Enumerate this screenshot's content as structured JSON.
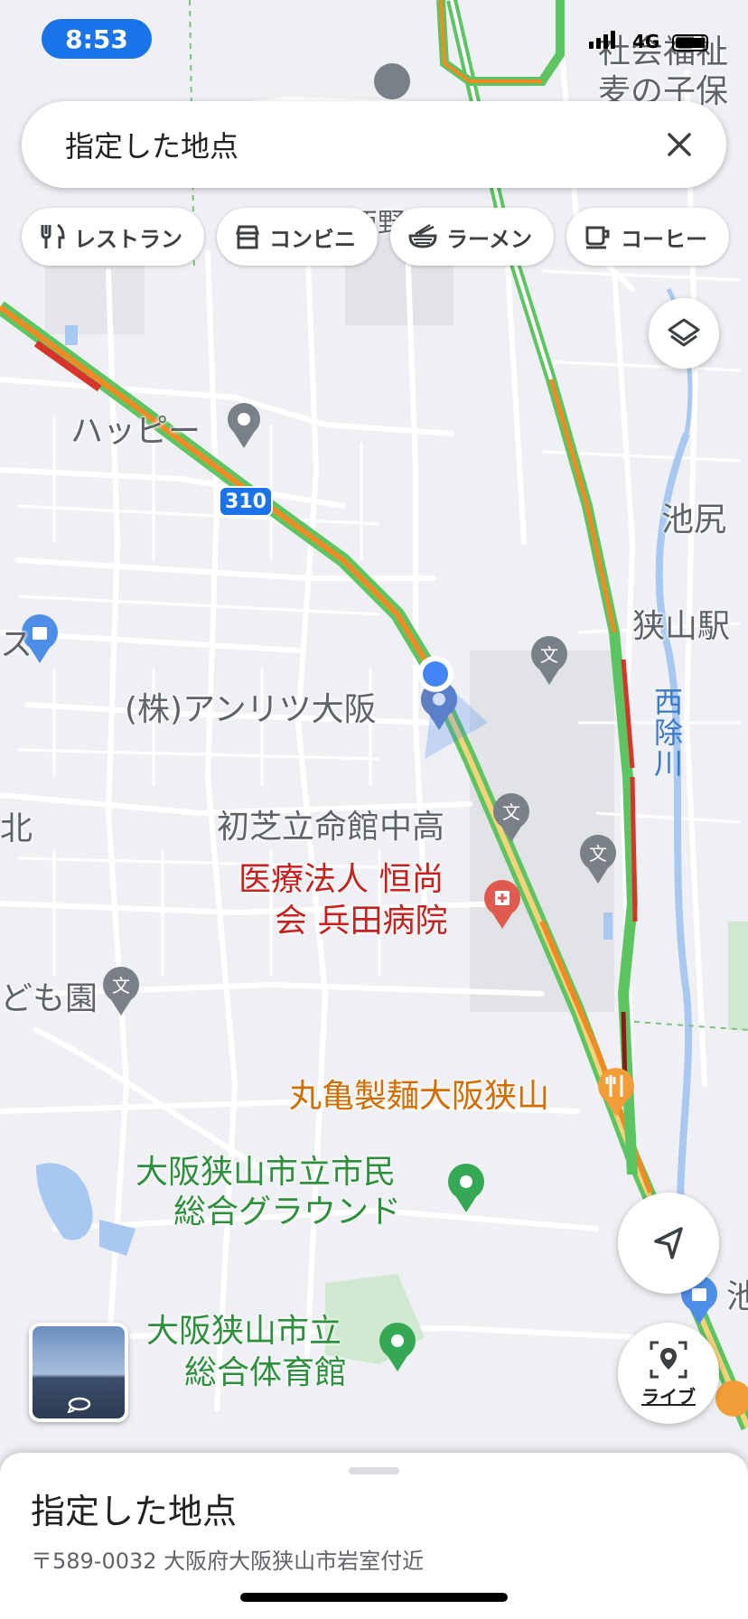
{
  "status_bar": {
    "time": "8:53",
    "network": "4G"
  },
  "search": {
    "text": "指定した地点",
    "clear_icon": "close-icon"
  },
  "chips": [
    {
      "label": "レストラン",
      "icon": "restaurant-icon"
    },
    {
      "label": "コンビニ",
      "icon": "store-icon"
    },
    {
      "label": "ラーメン",
      "icon": "ramen-icon"
    },
    {
      "label": "コーヒー",
      "icon": "coffee-icon"
    }
  ],
  "map": {
    "route_shield": "310",
    "labels": {
      "top_right_1": "社会福祉",
      "top_right_2": "麦の子保",
      "west_top": "西野",
      "happy": "ハッピー",
      "ikejiri": "池尻",
      "sayama_station": "狭山駅",
      "anritsu": "(株)アンリツ大阪",
      "nishiyoke": "西除川",
      "kita": "北",
      "ritsumeikan": "初芝立命館中高",
      "hospital_1": "医療法人 恒尚",
      "hospital_2": "会 兵田病院",
      "kodomoen": "ども園",
      "marugame": "丸亀製麺大阪狭山",
      "ground_1": "大阪狭山市立市民",
      "ground_2": "総合グラウンド",
      "gym_1": "大阪狭山市立",
      "gym_2": "総合体育館",
      "ike": "池",
      "left_su": "ス"
    },
    "colors": {
      "traffic_green": "#5cc461",
      "traffic_orange": "#f08a24",
      "traffic_red": "#d9342b",
      "location_blue": "#4285f4",
      "water": "#a8c8f2"
    }
  },
  "controls": {
    "layers_icon": "layers-icon",
    "navigate_icon": "navigation-arrow-icon",
    "live_label": "ライブ"
  },
  "sheet": {
    "title": "指定した地点",
    "address": "〒589-0032 大阪府大阪狭山市岩室付近"
  }
}
